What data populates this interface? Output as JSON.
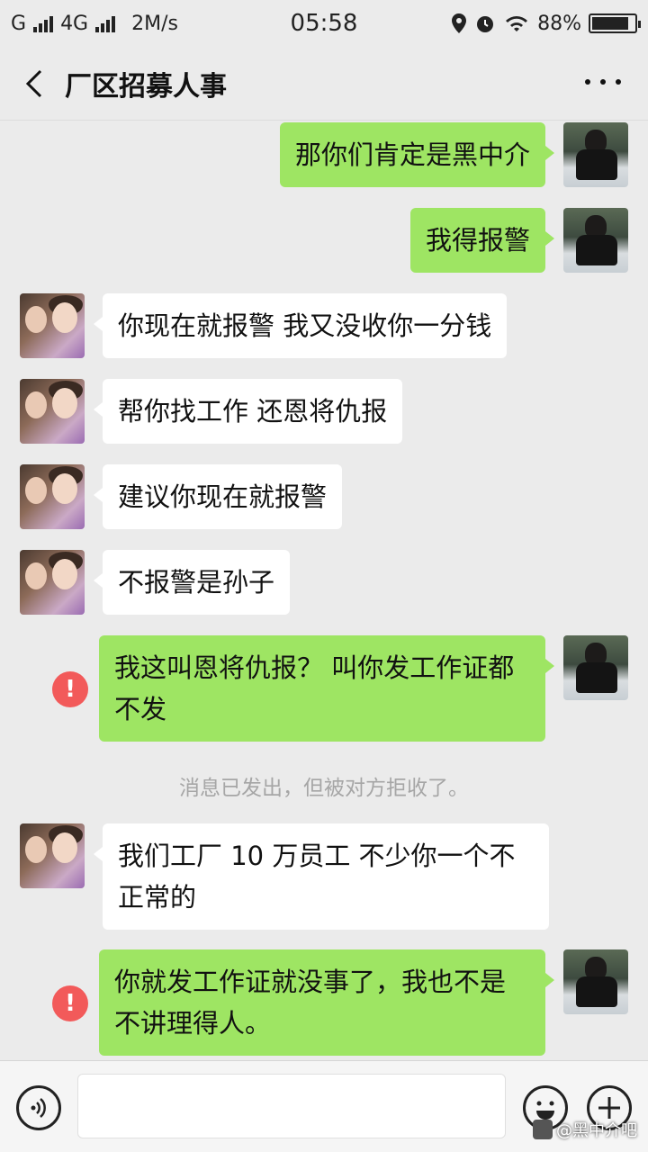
{
  "status_bar": {
    "carrier": "G",
    "network": "4G",
    "speed": "2M/s",
    "time": "05:58",
    "battery": "88%",
    "battery_level": 0.88
  },
  "nav": {
    "title": "厂区招募人事"
  },
  "messages": [
    {
      "side": "mine",
      "text": "那你们肯定是黑中介"
    },
    {
      "side": "mine",
      "text": "我得报警"
    },
    {
      "side": "theirs",
      "text": "你现在就报警 我又没收你一分钱"
    },
    {
      "side": "theirs",
      "text": "帮你找工作 还恩将仇报"
    },
    {
      "side": "theirs",
      "text": "建议你现在就报警"
    },
    {
      "side": "theirs",
      "text": "不报警是孙子"
    },
    {
      "side": "mine",
      "text": "我这叫恩将仇报？  叫你发工作证都不发",
      "failed": true
    },
    {
      "side": "theirs",
      "text": "我们工厂 10 万员工 不少你一个不正常的"
    },
    {
      "side": "mine",
      "text": "你就发工作证就没事了，我也不是不讲理得人。",
      "failed": true
    }
  ],
  "system_note": "消息已发出，但被对方拒收了。",
  "fail_glyph": "!",
  "input_bar": {
    "placeholder": ""
  },
  "watermark": "@黑中介吧",
  "colors": {
    "background": "#ebebeb",
    "my_bubble": "#9ee563",
    "their_bubble": "#ffffff",
    "fail_icon": "#f25a5a",
    "system_text": "#a6a6a6"
  }
}
